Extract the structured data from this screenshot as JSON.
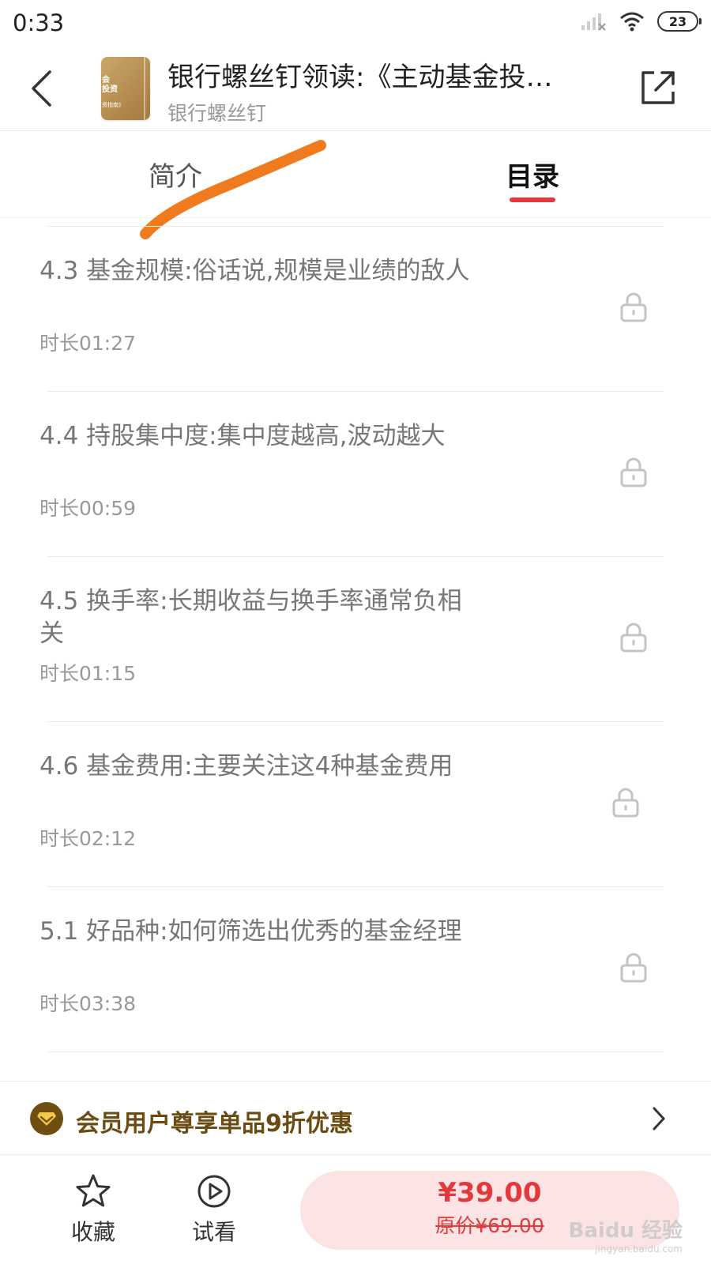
{
  "status_bar": {
    "time": "0:33",
    "battery": "23"
  },
  "header": {
    "title": "银行螺丝钉领读:《主动基金投…",
    "subtitle": "银行螺丝钉",
    "cover_text_1": "会\n投资",
    "cover_text_2": "资指南》"
  },
  "tabs": [
    {
      "label": "简介",
      "active": false
    },
    {
      "label": "目录",
      "active": true
    }
  ],
  "chapters": [
    {
      "title": "4.3 基金规模:俗话说,规模是业绩的敌人",
      "duration": "时长01:27",
      "locked": true
    },
    {
      "title": "4.4 持股集中度:集中度越高,波动越大",
      "duration": "时长00:59",
      "locked": true
    },
    {
      "title": "4.5 换手率:长期收益与换手率通常负相关",
      "duration": "时长01:15",
      "locked": true
    },
    {
      "title": "4.6 基金费用:主要关注这4种基金费用",
      "duration": "时长02:12",
      "locked": true
    },
    {
      "title": "5.1 好品种:如何筛选出优秀的基金经理",
      "duration": "时长03:38",
      "locked": true
    }
  ],
  "member_bar": {
    "text": "会员用户尊享单品9折优惠"
  },
  "bottom_bar": {
    "favorite_label": "收藏",
    "trial_label": "试看",
    "price": "¥39.00",
    "original_price": "原价¥69.00"
  },
  "watermark": {
    "main": "Baidu 经验",
    "sub": "jingyan.baidu.com"
  },
  "colors": {
    "accent": "#e4393c",
    "buy_bg": "#fde4e4",
    "member_text": "#6b4b12",
    "annotation": "#f07a1e"
  }
}
